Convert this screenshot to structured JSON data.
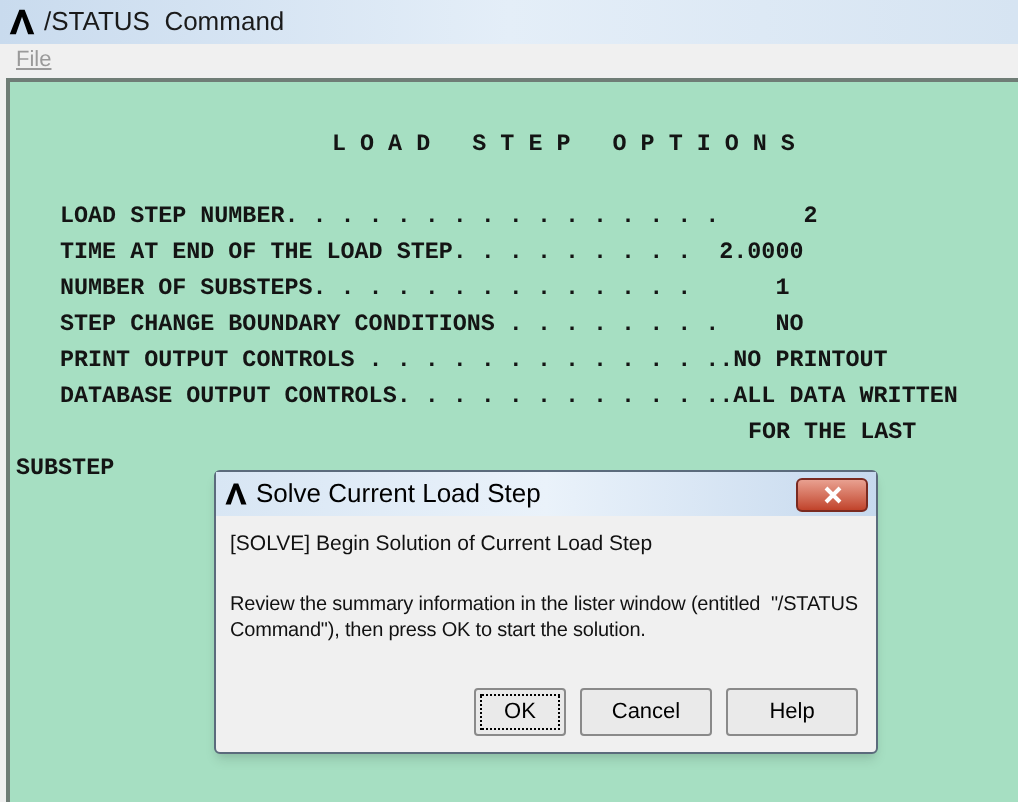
{
  "window": {
    "title": "/STATUS  Command"
  },
  "menu": [
    {
      "label": "File",
      "disabled": true
    }
  ],
  "listing": {
    "heading": "L O A D   S T E P   O P T I O N S",
    "lines": [
      {
        "text": "LOAD STEP NUMBER. . . . . . . . . . . . . . . .      2",
        "kind": "entry"
      },
      {
        "text": "TIME AT END OF THE LOAD STEP. . . . . . . . .  2.0000",
        "kind": "entry"
      },
      {
        "text": "NUMBER OF SUBSTEPS. . . . . . . . . . . . . .      1",
        "kind": "entry"
      },
      {
        "text": "STEP CHANGE BOUNDARY CONDITIONS . . . . . . . .    NO",
        "kind": "entry"
      },
      {
        "text": "PRINT OUTPUT CONTROLS . . . . . . . . . . . . ..NO PRINTOUT",
        "kind": "entry"
      },
      {
        "text": "DATABASE OUTPUT CONTROLS. . . . . . . . . . . ..ALL DATA WRITTEN",
        "kind": "entry"
      },
      {
        "text": "FOR THE LAST",
        "kind": "continuation"
      },
      {
        "text": "SUBSTEP",
        "kind": "wrap"
      }
    ]
  },
  "dialog": {
    "title": "Solve Current Load Step",
    "message": "[SOLVE] Begin Solution of Current Load Step",
    "detail": "Review the summary information in the lister window (entitled  \"/STATUS Command\"), then press OK to start the solution.",
    "buttons": [
      {
        "label": "OK",
        "focused": true
      },
      {
        "label": "Cancel",
        "focused": false
      },
      {
        "label": "Help",
        "focused": false
      }
    ]
  }
}
